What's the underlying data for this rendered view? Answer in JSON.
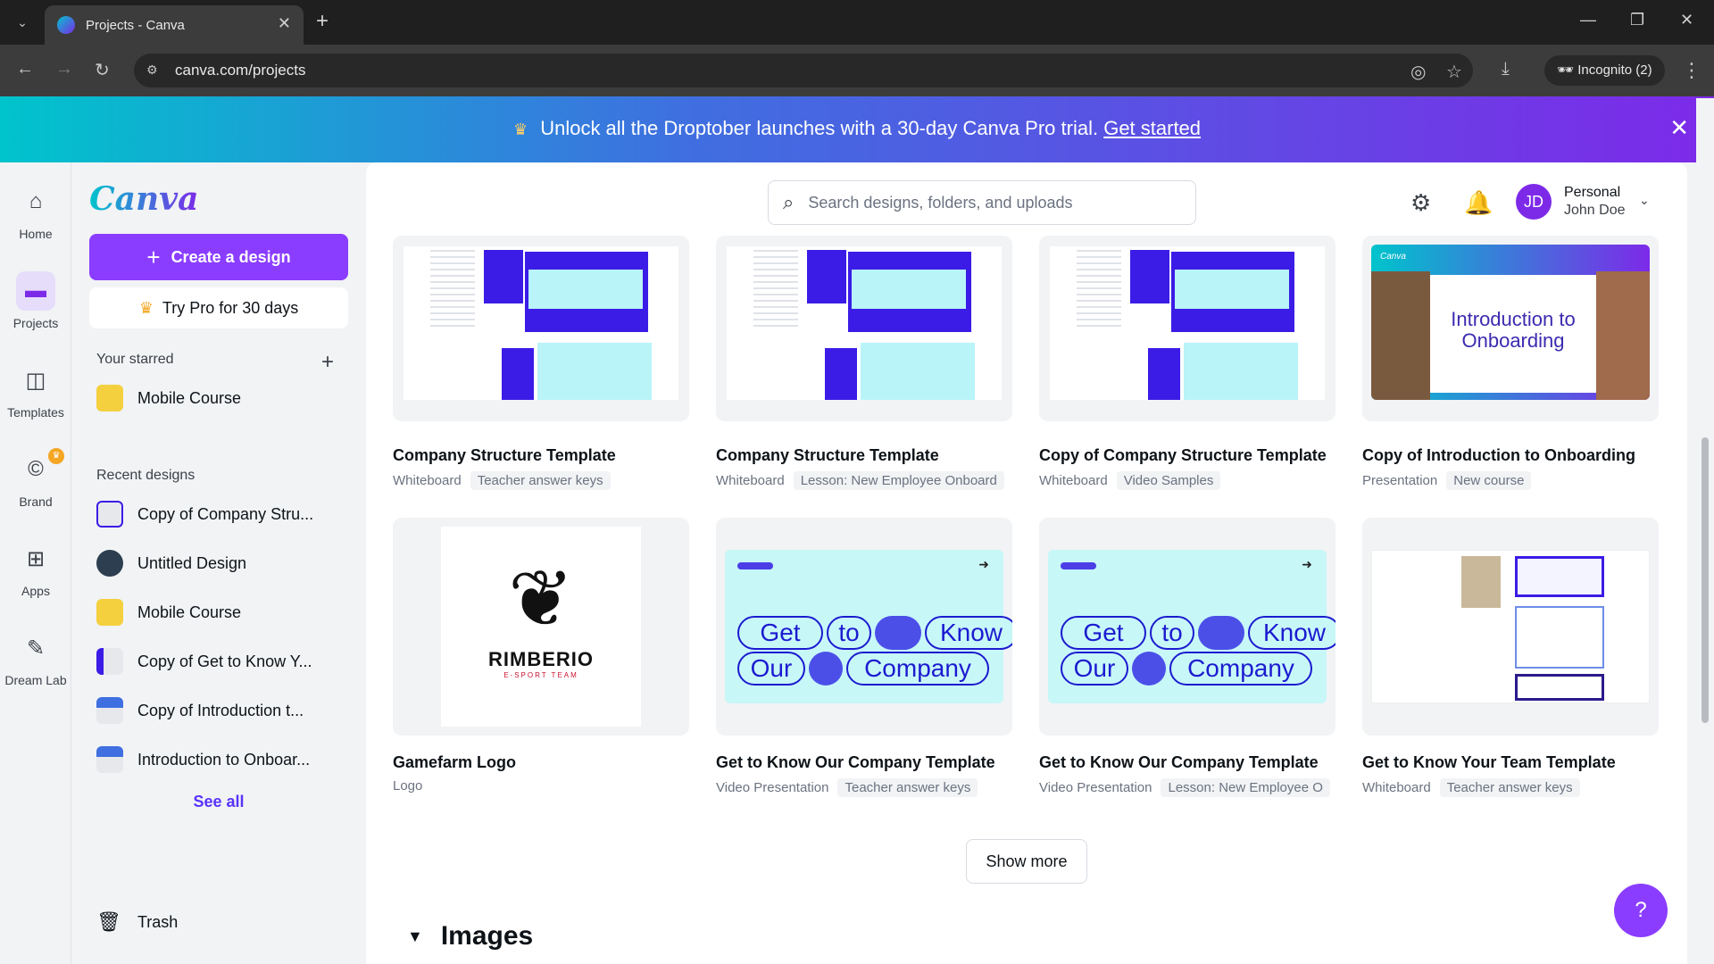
{
  "browser": {
    "tab_title": "Projects - Canva",
    "url": "canva.com/projects",
    "incognito_label": "Incognito (2)"
  },
  "promo": {
    "message": "Unlock all the Droptober launches with a 30-day Canva Pro trial.",
    "link": "Get started"
  },
  "rail": {
    "items": [
      {
        "label": "Home",
        "icon": "home-icon"
      },
      {
        "label": "Projects",
        "icon": "folder-icon"
      },
      {
        "label": "Templates",
        "icon": "templates-icon"
      },
      {
        "label": "Brand",
        "icon": "brand-icon"
      },
      {
        "label": "Apps",
        "icon": "apps-icon"
      },
      {
        "label": "Dream Lab",
        "icon": "dream-lab-icon"
      }
    ]
  },
  "side": {
    "logo": "Canva",
    "create_label": "Create a design",
    "pro_label": "Try Pro for 30 days",
    "starred_title": "Your starred",
    "starred": [
      {
        "label": "Mobile Course"
      }
    ],
    "recent_title": "Recent designs",
    "recent": [
      {
        "label": "Copy of Company Stru..."
      },
      {
        "label": "Untitled Design"
      },
      {
        "label": "Mobile Course"
      },
      {
        "label": "Copy of Get to Know Y..."
      },
      {
        "label": "Copy of Introduction t..."
      },
      {
        "label": "Introduction to Onboar..."
      }
    ],
    "see_all": "See all",
    "trash": "Trash"
  },
  "topbar": {
    "search_placeholder": "Search designs, folders, and uploads",
    "avatar_initials": "JD",
    "account_type": "Personal",
    "account_name": "John Doe"
  },
  "cards": [
    {
      "title": "Company Structure Template",
      "type": "Whiteboard",
      "tag": "Teacher answer keys"
    },
    {
      "title": "Company Structure Template",
      "type": "Whiteboard",
      "tag": "Lesson: New Employee Onboard"
    },
    {
      "title": "Copy of Company Structure Template",
      "type": "Whiteboard",
      "tag": "Video Samples"
    },
    {
      "title": "Copy of Introduction to Onboarding",
      "type": "Presentation",
      "tag": "New course"
    },
    {
      "title": "Gamefarm Logo",
      "type": "Logo",
      "tag": ""
    },
    {
      "title": "Get to Know Our Company Template",
      "type": "Video Presentation",
      "tag": "Teacher answer keys"
    },
    {
      "title": "Get to Know Our Company Template",
      "type": "Video Presentation",
      "tag": "Lesson: New Employee O"
    },
    {
      "title": "Get to Know Your Team Template",
      "type": "Whiteboard",
      "tag": "Teacher answer keys"
    }
  ],
  "previews": {
    "onboarding_text": "Introduction to Onboarding",
    "onboarding_brand": "Canva",
    "logo_name": "RIMBERIO",
    "logo_sub": "E-SPORT TEAM",
    "gtk_words": [
      "Get",
      "to",
      "Know",
      "Our",
      "Company"
    ]
  },
  "show_more": "Show more",
  "section_images": "Images",
  "help": "?",
  "colors": {
    "accent": "#8b3dff",
    "brand_start": "#00c4cc",
    "brand_end": "#7d2ae8"
  }
}
